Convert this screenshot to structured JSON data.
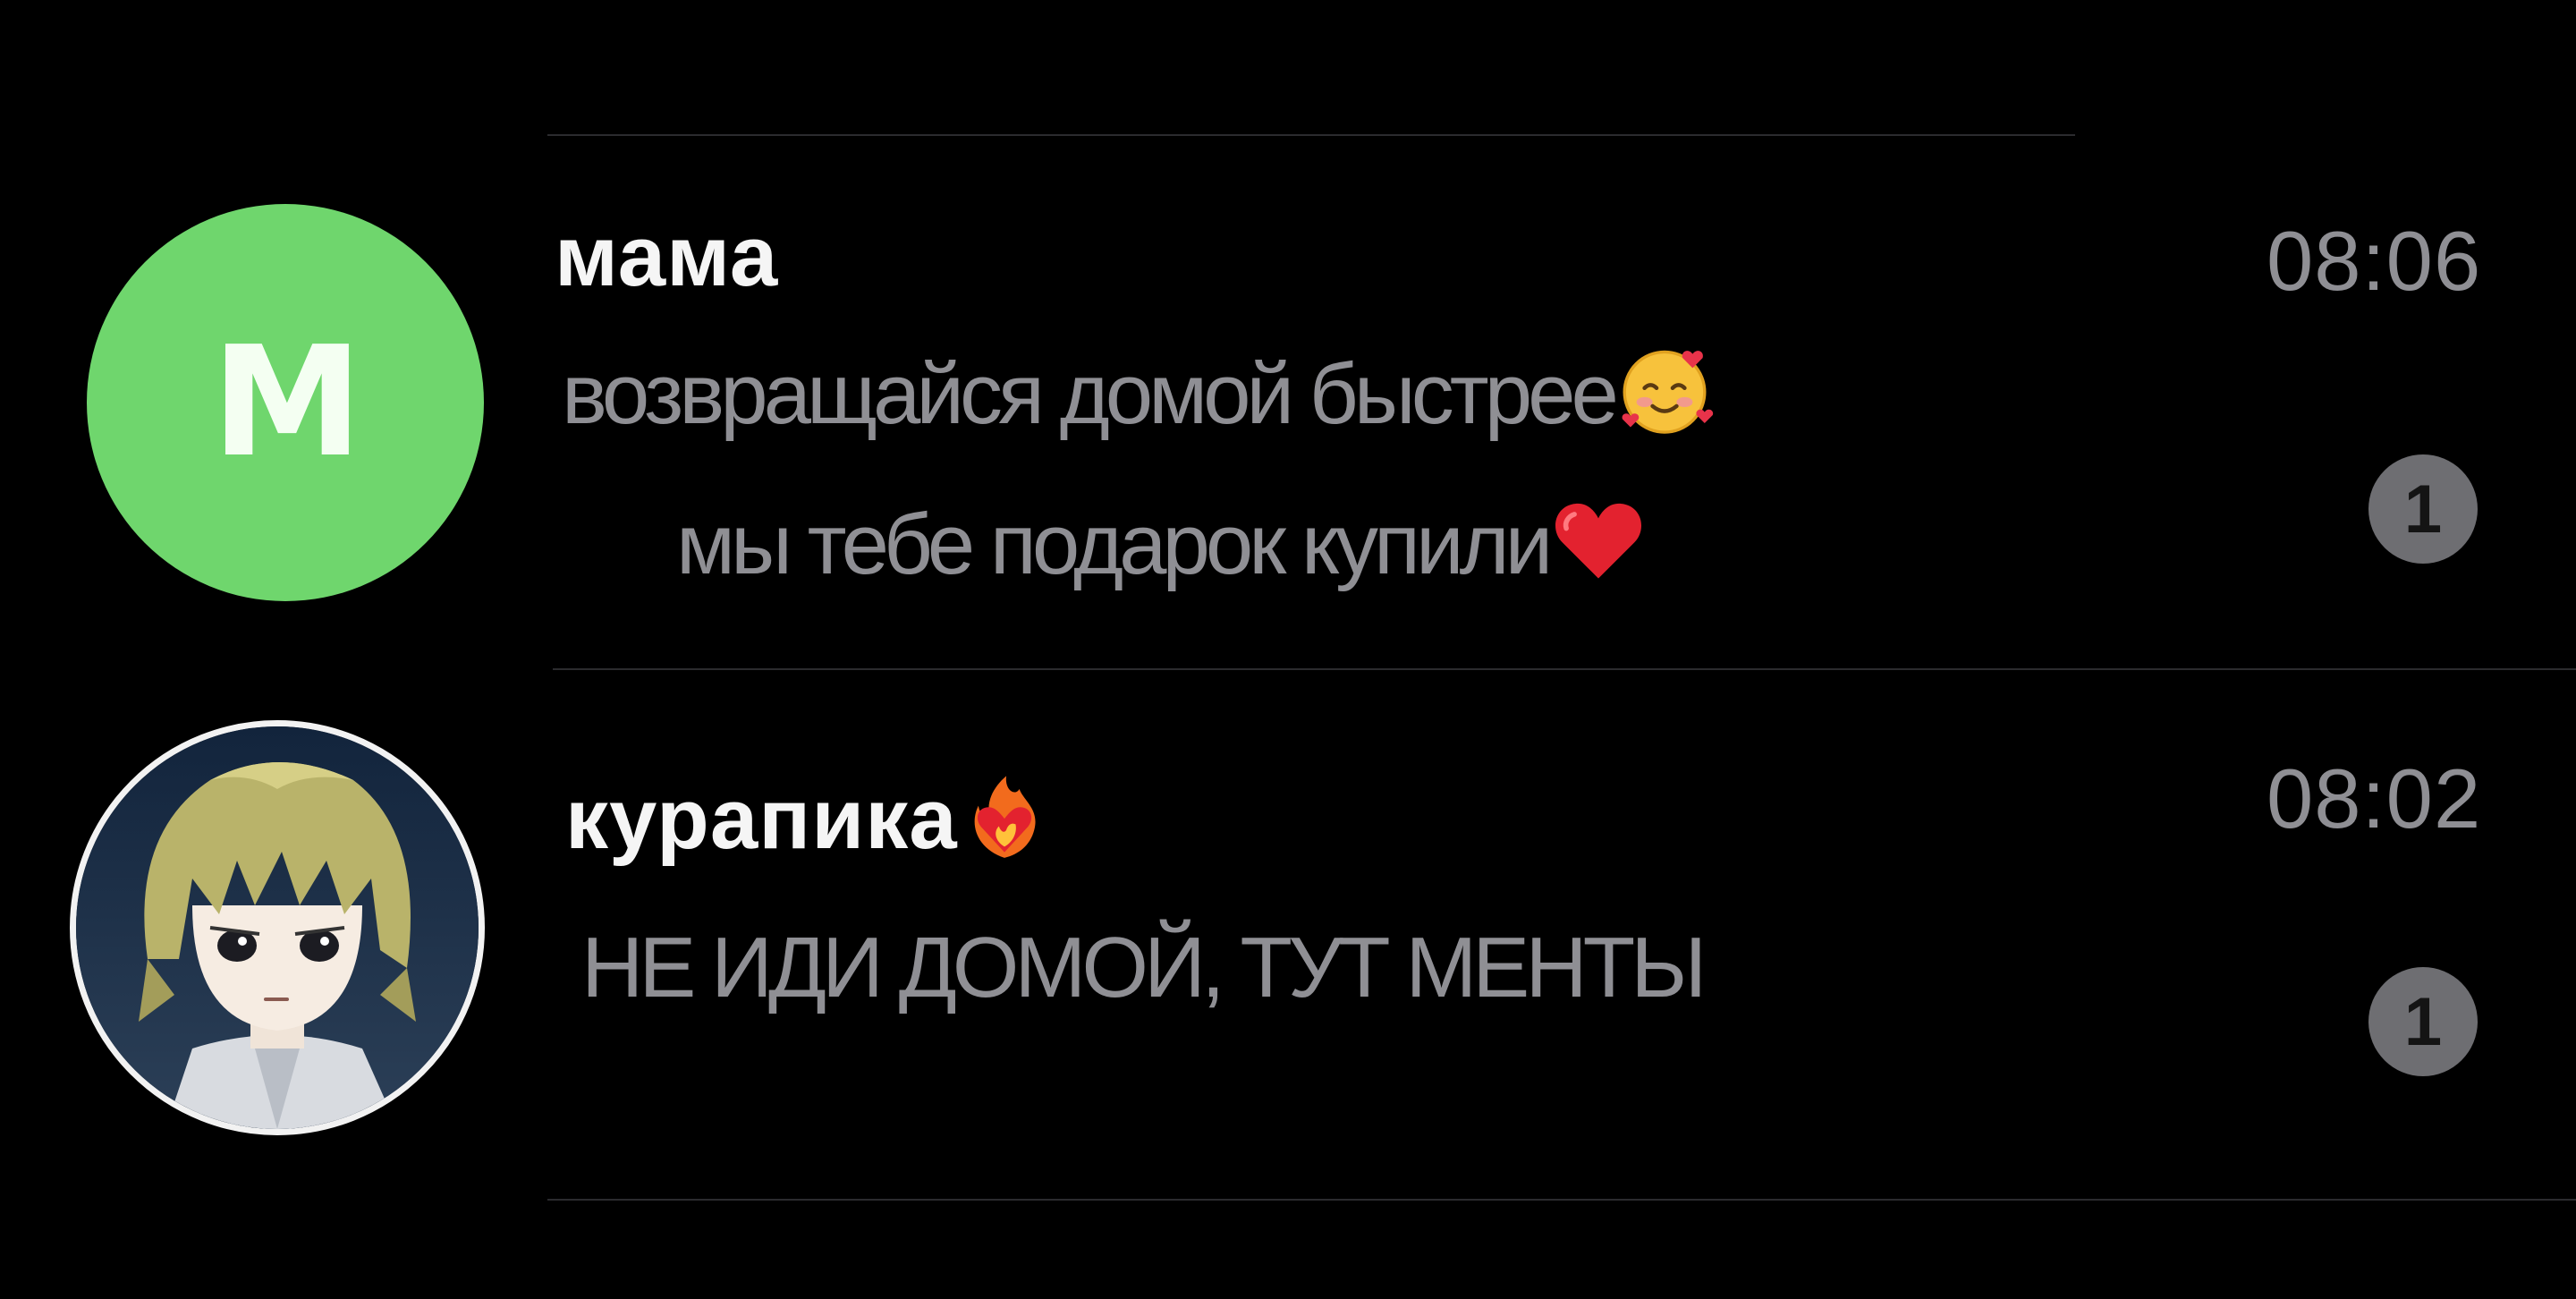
{
  "chats": [
    {
      "avatar_letter": "M",
      "avatar_color": "#6fd66d",
      "name": "мама",
      "time": "08:06",
      "message_line1": "возвращайся домой быстрее",
      "message_line2": "мы тебе подарок купили",
      "emoji_line1": "smiling-face-with-hearts-icon",
      "emoji_line2": "red-heart-icon",
      "unread_count": "1"
    },
    {
      "avatar": "anime-character-avatar",
      "name": "курапика",
      "name_emoji": "heart-on-fire-icon",
      "time": "08:02",
      "message_line1": "НЕ ИДИ ДОМОЙ, ТУТ МЕНТЫ",
      "unread_count": "1"
    }
  ],
  "colors": {
    "background": "#000000",
    "divider": "#2b2b2e",
    "secondary_text": "#8f8f94",
    "badge": "#6e6e72"
  }
}
